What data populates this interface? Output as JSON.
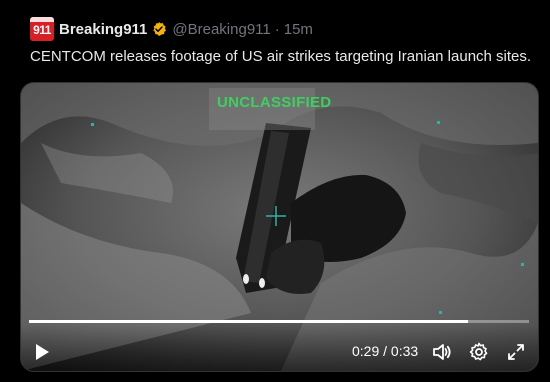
{
  "account": {
    "avatar_text": "911",
    "name": "Breaking911",
    "handle": "@Breaking911",
    "separator": "·",
    "time": "15m",
    "verified_color": "#f4b400"
  },
  "tweet": {
    "text": "CENTCOM releases footage of US air strikes targeting Iranian launch sites."
  },
  "video": {
    "overlay_label": "UNCLASSIFIED",
    "time_current": "0:29",
    "time_total": "0:33",
    "progress_fraction": 0.8788,
    "controls": [
      "play-icon",
      "volume-icon",
      "settings-icon",
      "fullscreen-icon"
    ]
  },
  "colors": {
    "background": "#000000",
    "text": "#e7e9ea",
    "muted": "#71767b",
    "overlay_green": "#3cd15f",
    "avatar_red": "#d81f26"
  }
}
